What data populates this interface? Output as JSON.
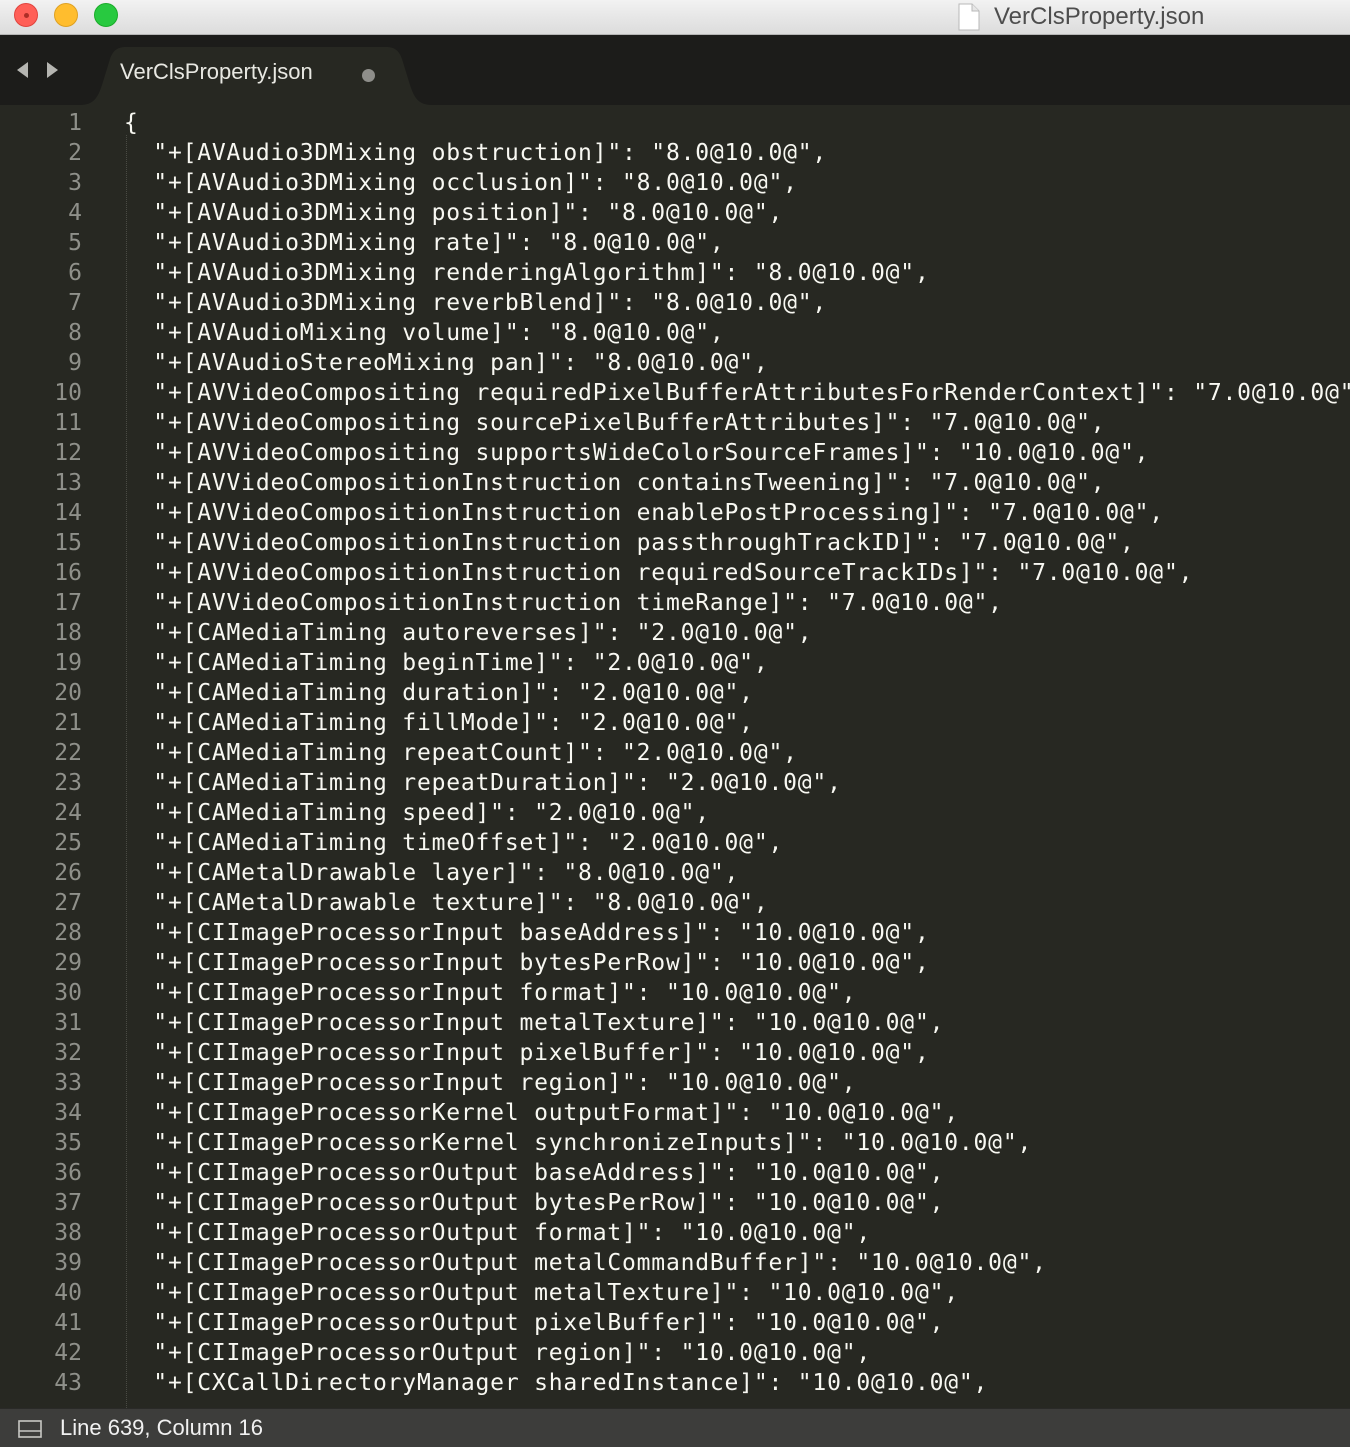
{
  "window": {
    "title": "VerClsProperty.json",
    "file_icon": "document-icon"
  },
  "tabs": [
    {
      "label": "VerClsProperty.json",
      "modified": true
    }
  ],
  "editor": {
    "lines": [
      {
        "n": "1",
        "text": "{"
      },
      {
        "n": "2",
        "text": "  \"+[AVAudio3DMixing obstruction]\": \"8.0@10.0@\","
      },
      {
        "n": "3",
        "text": "  \"+[AVAudio3DMixing occlusion]\": \"8.0@10.0@\","
      },
      {
        "n": "4",
        "text": "  \"+[AVAudio3DMixing position]\": \"8.0@10.0@\","
      },
      {
        "n": "5",
        "text": "  \"+[AVAudio3DMixing rate]\": \"8.0@10.0@\","
      },
      {
        "n": "6",
        "text": "  \"+[AVAudio3DMixing renderingAlgorithm]\": \"8.0@10.0@\","
      },
      {
        "n": "7",
        "text": "  \"+[AVAudio3DMixing reverbBlend]\": \"8.0@10.0@\","
      },
      {
        "n": "8",
        "text": "  \"+[AVAudioMixing volume]\": \"8.0@10.0@\","
      },
      {
        "n": "9",
        "text": "  \"+[AVAudioStereoMixing pan]\": \"8.0@10.0@\","
      },
      {
        "n": "10",
        "text": "  \"+[AVVideoCompositing requiredPixelBufferAttributesForRenderContext]\": \"7.0@10.0@\","
      },
      {
        "n": "11",
        "text": "  \"+[AVVideoCompositing sourcePixelBufferAttributes]\": \"7.0@10.0@\","
      },
      {
        "n": "12",
        "text": "  \"+[AVVideoCompositing supportsWideColorSourceFrames]\": \"10.0@10.0@\","
      },
      {
        "n": "13",
        "text": "  \"+[AVVideoCompositionInstruction containsTweening]\": \"7.0@10.0@\","
      },
      {
        "n": "14",
        "text": "  \"+[AVVideoCompositionInstruction enablePostProcessing]\": \"7.0@10.0@\","
      },
      {
        "n": "15",
        "text": "  \"+[AVVideoCompositionInstruction passthroughTrackID]\": \"7.0@10.0@\","
      },
      {
        "n": "16",
        "text": "  \"+[AVVideoCompositionInstruction requiredSourceTrackIDs]\": \"7.0@10.0@\","
      },
      {
        "n": "17",
        "text": "  \"+[AVVideoCompositionInstruction timeRange]\": \"7.0@10.0@\","
      },
      {
        "n": "18",
        "text": "  \"+[CAMediaTiming autoreverses]\": \"2.0@10.0@\","
      },
      {
        "n": "19",
        "text": "  \"+[CAMediaTiming beginTime]\": \"2.0@10.0@\","
      },
      {
        "n": "20",
        "text": "  \"+[CAMediaTiming duration]\": \"2.0@10.0@\","
      },
      {
        "n": "21",
        "text": "  \"+[CAMediaTiming fillMode]\": \"2.0@10.0@\","
      },
      {
        "n": "22",
        "text": "  \"+[CAMediaTiming repeatCount]\": \"2.0@10.0@\","
      },
      {
        "n": "23",
        "text": "  \"+[CAMediaTiming repeatDuration]\": \"2.0@10.0@\","
      },
      {
        "n": "24",
        "text": "  \"+[CAMediaTiming speed]\": \"2.0@10.0@\","
      },
      {
        "n": "25",
        "text": "  \"+[CAMediaTiming timeOffset]\": \"2.0@10.0@\","
      },
      {
        "n": "26",
        "text": "  \"+[CAMetalDrawable layer]\": \"8.0@10.0@\","
      },
      {
        "n": "27",
        "text": "  \"+[CAMetalDrawable texture]\": \"8.0@10.0@\","
      },
      {
        "n": "28",
        "text": "  \"+[CIImageProcessorInput baseAddress]\": \"10.0@10.0@\","
      },
      {
        "n": "29",
        "text": "  \"+[CIImageProcessorInput bytesPerRow]\": \"10.0@10.0@\","
      },
      {
        "n": "30",
        "text": "  \"+[CIImageProcessorInput format]\": \"10.0@10.0@\","
      },
      {
        "n": "31",
        "text": "  \"+[CIImageProcessorInput metalTexture]\": \"10.0@10.0@\","
      },
      {
        "n": "32",
        "text": "  \"+[CIImageProcessorInput pixelBuffer]\": \"10.0@10.0@\","
      },
      {
        "n": "33",
        "text": "  \"+[CIImageProcessorInput region]\": \"10.0@10.0@\","
      },
      {
        "n": "34",
        "text": "  \"+[CIImageProcessorKernel outputFormat]\": \"10.0@10.0@\","
      },
      {
        "n": "35",
        "text": "  \"+[CIImageProcessorKernel synchronizeInputs]\": \"10.0@10.0@\","
      },
      {
        "n": "36",
        "text": "  \"+[CIImageProcessorOutput baseAddress]\": \"10.0@10.0@\","
      },
      {
        "n": "37",
        "text": "  \"+[CIImageProcessorOutput bytesPerRow]\": \"10.0@10.0@\","
      },
      {
        "n": "38",
        "text": "  \"+[CIImageProcessorOutput format]\": \"10.0@10.0@\","
      },
      {
        "n": "39",
        "text": "  \"+[CIImageProcessorOutput metalCommandBuffer]\": \"10.0@10.0@\","
      },
      {
        "n": "40",
        "text": "  \"+[CIImageProcessorOutput metalTexture]\": \"10.0@10.0@\","
      },
      {
        "n": "41",
        "text": "  \"+[CIImageProcessorOutput pixelBuffer]\": \"10.0@10.0@\","
      },
      {
        "n": "42",
        "text": "  \"+[CIImageProcessorOutput region]\": \"10.0@10.0@\","
      },
      {
        "n": "43",
        "text": "  \"+[CXCallDirectoryManager sharedInstance]\": \"10.0@10.0@\","
      }
    ]
  },
  "statusbar": {
    "text": "Line 639, Column 16",
    "panel_icon": "panel-toggle-icon"
  },
  "colors": {
    "editor_bg": "#272822",
    "text": "#f8f8f2",
    "line_numbers": "#8f908a",
    "tab_bg": "#1c1c1a"
  }
}
